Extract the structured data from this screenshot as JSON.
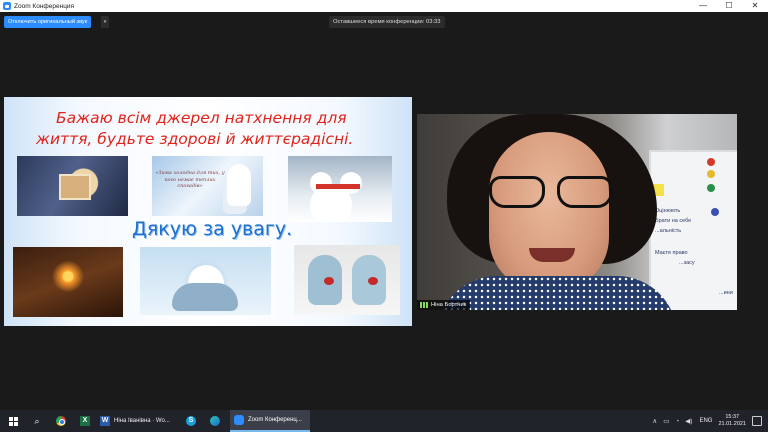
{
  "window": {
    "title": "Zoom Конференция",
    "controls": {
      "minimize": "—",
      "maximize": "☐",
      "close": "✕"
    }
  },
  "toolbar": {
    "original_sound_label": "Отключить оригинальный звук",
    "caret": "▾",
    "timer_label": "Оставшееся время конференции: 03:33"
  },
  "slide": {
    "line1": "Бажаю всім джерел натхнення для",
    "line2": "життя, будьте здорові й життєрадісні.",
    "thanks": "Дякую за увагу.",
    "quote": "«Зима холодна для тих, у кого немає теплих спогадів»"
  },
  "video": {
    "participant_name": "Ніна Бортник",
    "board_lines": [
      "Оцінюють",
      "Брати на себе",
      "...альність",
      "Маєте право",
      "...засу",
      "...ини"
    ]
  },
  "taskbar": {
    "search_icon": "⌕",
    "excel_letter": "X",
    "word_letter": "W",
    "word_label": "Ніна Іванівна · Wo...",
    "skype_letter": "S",
    "zoom_label": "Zoom Конференц...",
    "tray_caret": "∧",
    "lang": "ENG",
    "time": "15:37",
    "date": "21.01.2021"
  },
  "colors": {
    "zoom_blue": "#2d8cff",
    "slide_red": "#e0241b",
    "slide_blue": "#1d6fd1",
    "taskbar": "#20232a"
  }
}
